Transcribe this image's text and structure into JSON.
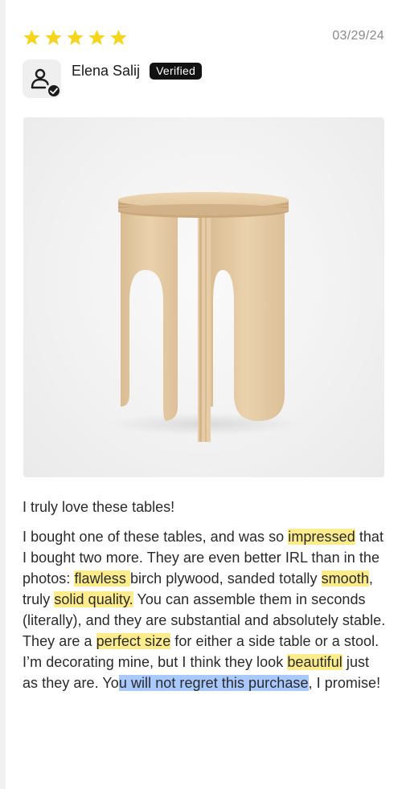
{
  "review": {
    "rating": 5,
    "max_rating": 5,
    "date": "03/29/24",
    "author": "Elena Salij",
    "badge": "Verified",
    "title": "I truly love these tables!",
    "body": [
      {
        "text": "I bought one of these tables, and was so ",
        "highlight": null
      },
      {
        "text": "impressed",
        "highlight": "yellow"
      },
      {
        "text": " that I bought two more. They are even better IRL than in the photos: ",
        "highlight": null
      },
      {
        "text": "flawless ",
        "highlight": "yellow"
      },
      {
        "text": " birch plywood, sanded totally ",
        "highlight": null
      },
      {
        "text": "smooth",
        "highlight": "yellow"
      },
      {
        "text": ", truly ",
        "highlight": null
      },
      {
        "text": "solid quality.",
        "highlight": "yellow"
      },
      {
        "text": " You can assemble them in seconds (literally), and they are substantial and absolutely stable. They are a ",
        "highlight": null
      },
      {
        "text": "perfect size",
        "highlight": "yellow"
      },
      {
        "text": " for either a side table or a stool. I’m decorating mine, but I think they look ",
        "highlight": null
      },
      {
        "text": "beautiful",
        "highlight": "yellow"
      },
      {
        "text": " just as they are. Yo",
        "highlight": null
      },
      {
        "text": "u will not regret this purchase",
        "highlight": "blue"
      },
      {
        "text": ", I promise!",
        "highlight": null
      }
    ]
  },
  "icons": {
    "star": "star-icon",
    "avatar": "user-icon",
    "verified_check": "check-icon"
  },
  "colors": {
    "star": "#f7d51d",
    "highlight_yellow": "#fdec8c",
    "highlight_blue": "#a9c8fb",
    "badge_bg": "#121212",
    "date": "#8a8a8a"
  }
}
